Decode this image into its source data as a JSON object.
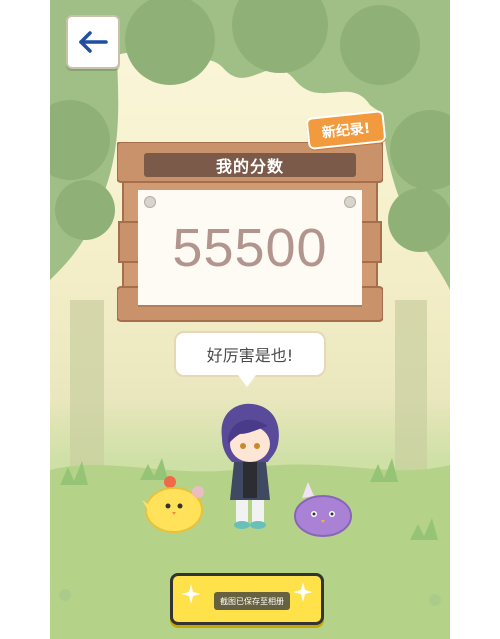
{
  "header": {
    "back_icon": "arrow-left-icon"
  },
  "badge": {
    "label": "新纪录!"
  },
  "score_panel": {
    "title": "我的分数",
    "score": "55500"
  },
  "speech": {
    "text": "好厉害是也!"
  },
  "action_button": {
    "toast": "截图已保存至相册"
  },
  "colors": {
    "button_yellow": "#ffe14a",
    "badge_orange": "#f29a3e",
    "wood": "#c9926b",
    "plank_dark": "#7b5a49",
    "score_text": "#b3958f"
  }
}
